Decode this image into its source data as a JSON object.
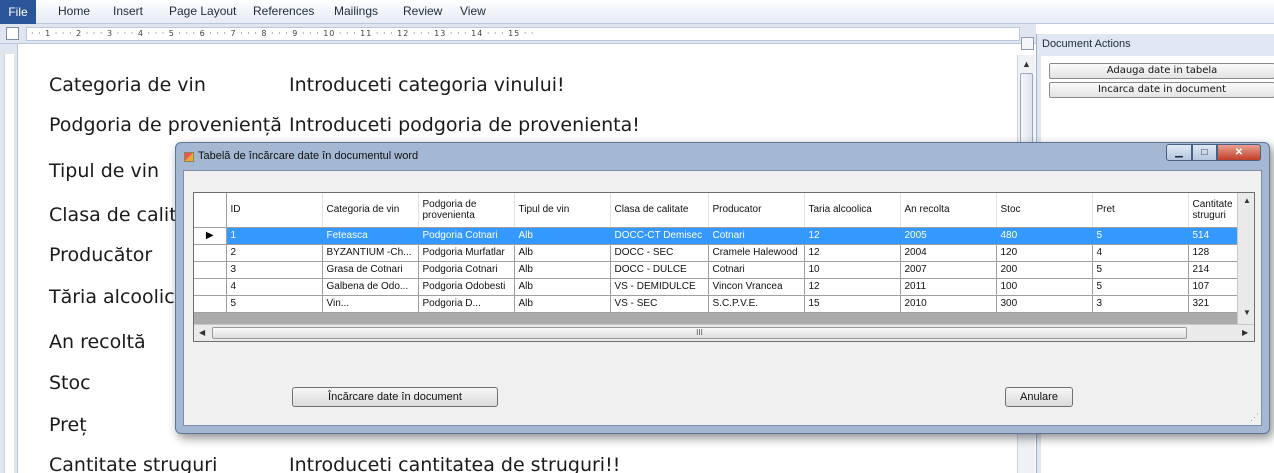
{
  "ribbon": {
    "file": "File",
    "tabs": [
      "Home",
      "Insert",
      "Page Layout",
      "References",
      "Mailings",
      "Review",
      "View"
    ]
  },
  "ruler": {
    "text": "· · 1 · · · 2 · · · 3 · · · 4 · · · 5 · · · 6 · · · 7 · · · 8 · · · 9 · · · 10 · · · 11 · · · 12 · · · 13 · · · 14 · · · 15 · ·"
  },
  "document": {
    "lines": [
      {
        "label": "Categoria de vin",
        "value": "Introduceti categoria vinului!"
      },
      {
        "label": "Podgoria de proveniență",
        "value": "Introduceti podgoria de provenienta!"
      },
      {
        "label": "Tipul de vin",
        "value": ""
      },
      {
        "label": "Clasa de calitate",
        "value": ""
      },
      {
        "label": "Producător",
        "value": ""
      },
      {
        "label": "Tăria alcoolică",
        "value": ""
      },
      {
        "label": "An recoltă",
        "value": ""
      },
      {
        "label": "Stoc",
        "value": ""
      },
      {
        "label": "Preț",
        "value": ""
      },
      {
        "label": "Cantitate struguri",
        "value": "Introduceti cantitatea de struguri!!"
      }
    ]
  },
  "pane": {
    "title": "Document Actions",
    "buttons": [
      "Adauga date in tabela",
      "Incarca date in document"
    ]
  },
  "dialog": {
    "title": "Tabelă de încărcare date în documentul word",
    "columns": [
      "ID",
      "Categoria de vin",
      "Podgoria de provenienta",
      "Tipul de vin",
      "Clasa de calitate",
      "Producator",
      "Taria alcoolica",
      "An recolta",
      "Stoc",
      "Pret",
      "Cantitate struguri"
    ],
    "rows": [
      [
        "1",
        "Feteasca",
        "Podgoria Cotnari",
        "Alb",
        "DOCC-CT Demisec",
        "Cotnari",
        "12",
        "2005",
        "480",
        "5",
        "514"
      ],
      [
        "2",
        "BYZANTIUM -Ch...",
        "Podgoria Murfatlar",
        "Alb",
        "DOCC - SEC",
        "Cramele Halewood",
        "12",
        "2004",
        "120",
        "4",
        "128"
      ],
      [
        "3",
        "Grasa de Cotnari",
        "Podgoria Cotnari",
        "Alb",
        "DOCC - DULCE",
        "Cotnari",
        "10",
        "2007",
        "200",
        "5",
        "214"
      ],
      [
        "4",
        "Galbena de Odo...",
        "Podgoria Odobesti",
        "Alb",
        "VS - DEMIDULCE",
        "Vincon Vrancea",
        "12",
        "2011",
        "100",
        "5",
        "107"
      ],
      [
        "5",
        "Vin...",
        "Podgoria D...",
        "Alb",
        "VS - SEC",
        "S.C.P.V.E.",
        "15",
        "2010",
        "300",
        "3",
        "321"
      ]
    ],
    "selected_row": 0,
    "load_button": "Încărcare date în document",
    "cancel_button": "Anulare",
    "hscroll_grip": "III"
  }
}
